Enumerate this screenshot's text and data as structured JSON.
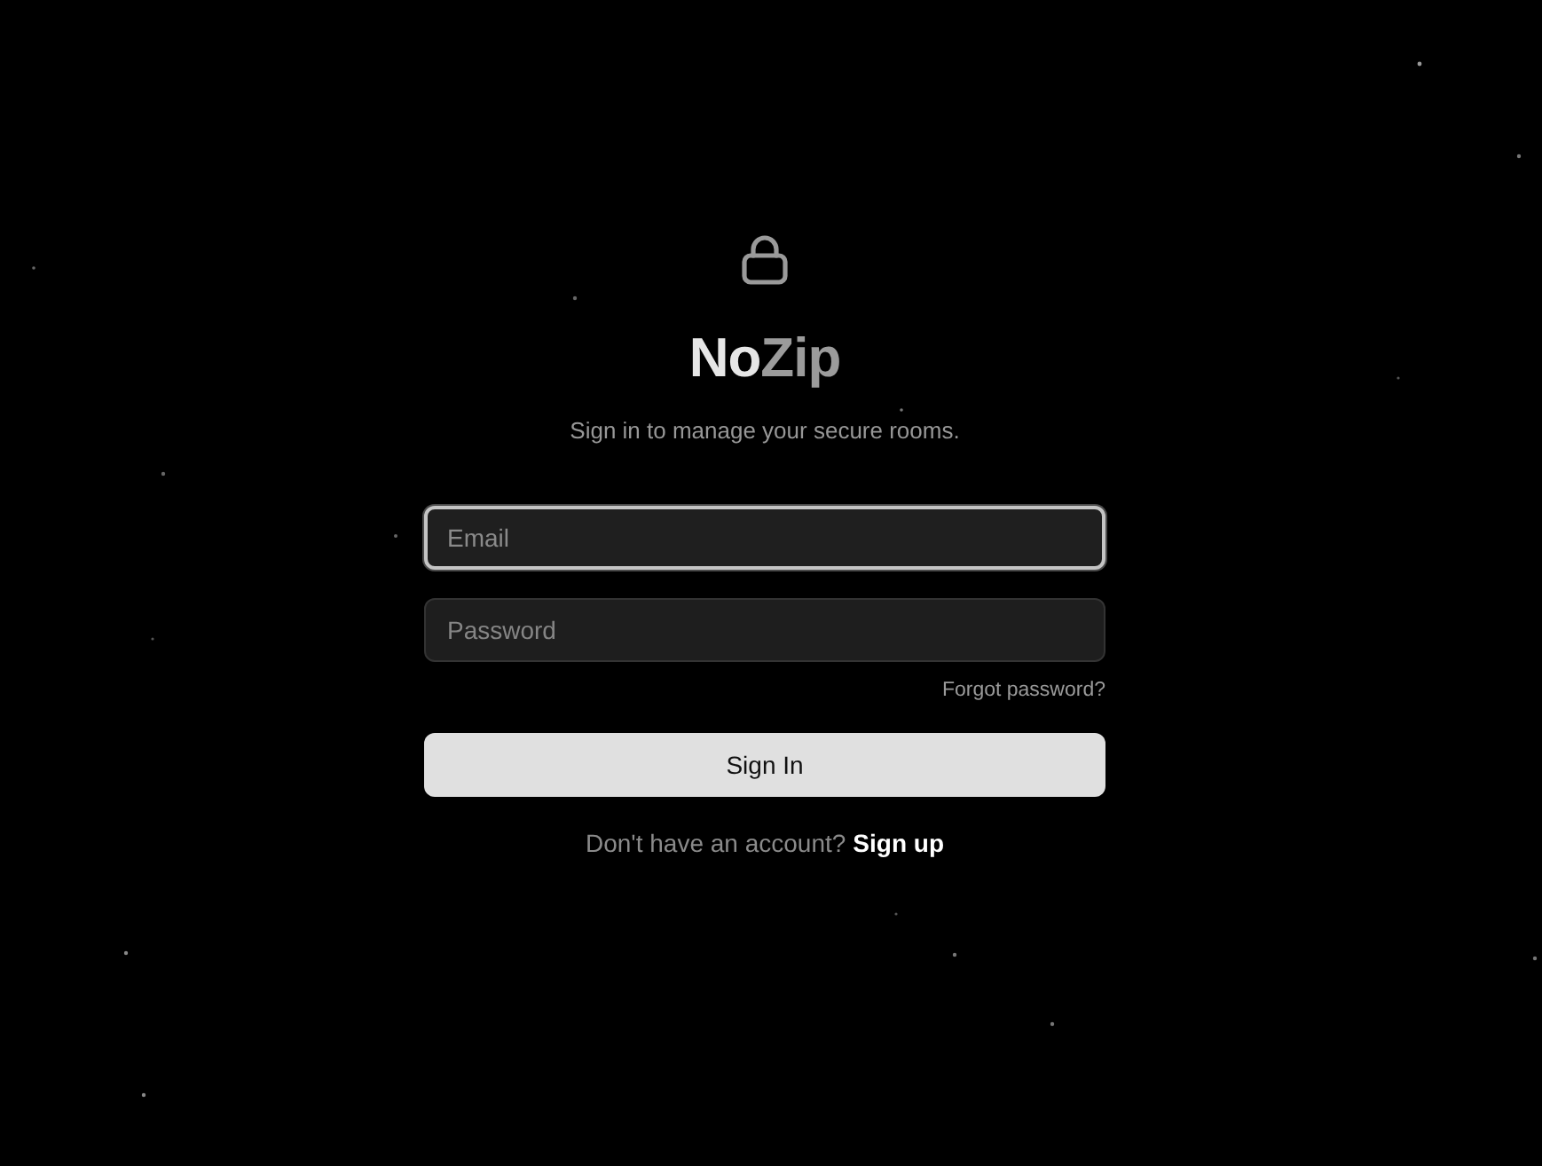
{
  "header": {
    "brand": [
      {
        "text": "No",
        "color": "#e6e6e6"
      },
      {
        "text": "Zip",
        "color": "#9b9b9b"
      }
    ],
    "subtitle": "Sign in to manage your secure rooms."
  },
  "form": {
    "email_field": {
      "placeholder": "Email",
      "focused": true
    },
    "password_field": {
      "placeholder": "Password",
      "focused": false
    },
    "forgot_link": "Forgot password?",
    "submit": "Sign In",
    "signup_prompt": "Don't have an account?",
    "signup_link": "Sign up"
  }
}
